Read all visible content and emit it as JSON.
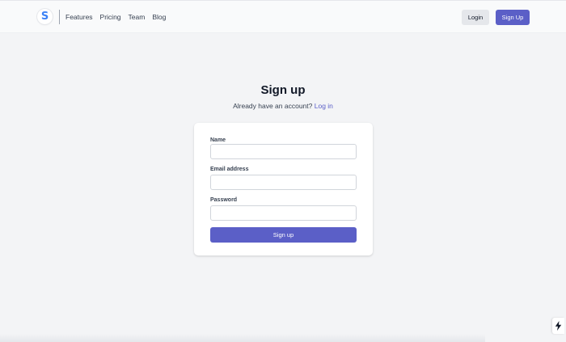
{
  "header": {
    "logo_letter": "S",
    "nav": [
      {
        "label": "Features"
      },
      {
        "label": "Pricing"
      },
      {
        "label": "Team"
      },
      {
        "label": "Blog"
      }
    ],
    "login_label": "Login",
    "signup_label": "Sign Up"
  },
  "main": {
    "title": "Sign up",
    "subtitle_text": "Already have an account?",
    "login_link": "Log in",
    "form": {
      "name_label": "Name",
      "name_value": "",
      "email_label": "Email address",
      "email_value": "",
      "password_label": "Password",
      "password_value": "",
      "submit_label": "Sign up"
    }
  },
  "colors": {
    "accent": "#5b5fc7",
    "background": "#f3f4f6",
    "logo": "#3b82f6"
  },
  "icons": {
    "logo": "s-logo-icon",
    "badge": "lightning-bolt-icon"
  }
}
